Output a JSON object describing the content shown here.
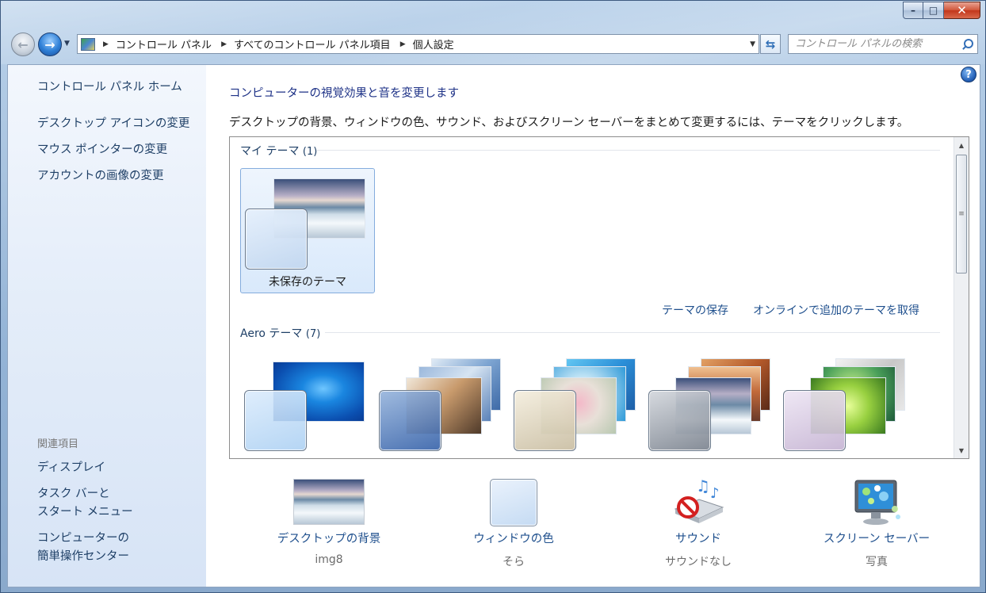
{
  "window": {
    "caption_buttons": {
      "minimize": "–",
      "maximize": "□",
      "close": "✕"
    }
  },
  "nav": {
    "breadcrumbs": [
      "コントロール パネル",
      "すべてのコントロール パネル項目",
      "個人設定"
    ],
    "search_placeholder": "コントロール パネルの検索",
    "icons": {
      "back": "back-arrow",
      "forward": "forward-arrow",
      "refresh": "refresh",
      "search": "magnifier"
    }
  },
  "sidebar": {
    "home_label": "コントロール パネル ホーム",
    "items": [
      "デスクトップ アイコンの変更",
      "マウス ポインターの変更",
      "アカウントの画像の変更"
    ],
    "related_heading": "関連項目",
    "related": [
      "ディスプレイ",
      "タスク バーと\nスタート メニュー",
      "コンピューターの\n簡単操作センター"
    ]
  },
  "main": {
    "title": "コンピューターの視覚効果と音を変更します",
    "description": "デスクトップの背景、ウィンドウの色、サウンド、およびスクリーン セーバーをまとめて変更するには、テーマをクリックします。",
    "help_label": "?",
    "my_themes": {
      "label": "マイ テーマ",
      "count": "(1)",
      "items": [
        {
          "name": "未保存のテーマ",
          "selected": true
        }
      ]
    },
    "actions": {
      "save_theme": "テーマの保存",
      "get_more_online": "オンラインで追加のテーマを取得"
    },
    "aero_themes": {
      "label": "Aero テーマ",
      "count": "(7)"
    }
  },
  "settings": [
    {
      "link": "デスクトップの背景",
      "value": "img8",
      "icon": "desktop-background-thumbnail"
    },
    {
      "link": "ウィンドウの色",
      "value": "そら",
      "icon": "window-color-swatch"
    },
    {
      "link": "サウンド",
      "value": "サウンドなし",
      "icon": "sound-muted"
    },
    {
      "link": "スクリーン セーバー",
      "value": "写真",
      "icon": "screen-saver-monitor"
    }
  ],
  "colors": {
    "link": "#1e4f8d",
    "title": "#1e3287",
    "selection_bg": "#d9e9fb",
    "selection_border": "#84acdd"
  }
}
